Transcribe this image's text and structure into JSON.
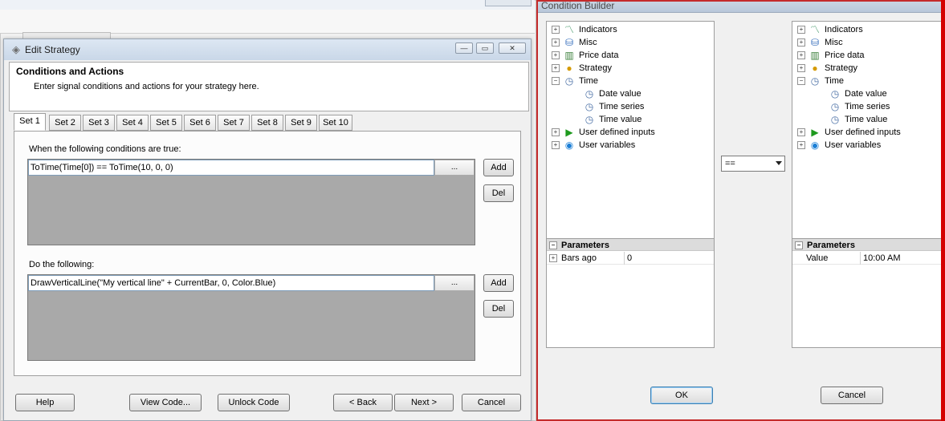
{
  "edit_strategy": {
    "title": "Edit Strategy",
    "header_title": "Conditions and Actions",
    "header_subtitle": "Enter signal conditions and actions for your strategy here.",
    "tabs": [
      "Set 1",
      "Set 2",
      "Set 3",
      "Set 4",
      "Set 5",
      "Set 6",
      "Set 7",
      "Set 8",
      "Set 9",
      "Set 10"
    ],
    "active_tab": "Set 1",
    "conditions_label": "When the following conditions are true:",
    "condition_row": "ToTime(Time[0]) == ToTime(10, 0, 0)",
    "actions_label": "Do the following:",
    "action_row": "DrawVerticalLine(\"My vertical line\" + CurrentBar, 0, Color.Blue)",
    "ellipsis": "...",
    "add_label": "Add",
    "del_label": "Del",
    "buttons": {
      "help": "Help",
      "view_code": "View Code...",
      "unlock_code": "Unlock Code",
      "back": "< Back",
      "next": "Next >",
      "cancel": "Cancel"
    }
  },
  "condition_builder": {
    "title": "Condition Builder",
    "tree": [
      {
        "label": "Indicators",
        "icon": "chart-line-icon",
        "expander": "+"
      },
      {
        "label": "Misc",
        "icon": "database-icon",
        "expander": "+"
      },
      {
        "label": "Price data",
        "icon": "bar-chart-icon",
        "expander": "+"
      },
      {
        "label": "Strategy",
        "icon": "coin-icon",
        "expander": "+"
      },
      {
        "label": "Time",
        "icon": "clock-icon",
        "expander": "-"
      },
      {
        "label": "Date value",
        "icon": "clock-icon",
        "child": true
      },
      {
        "label": "Time series",
        "icon": "clock-icon",
        "child": true
      },
      {
        "label": "Time value",
        "icon": "clock-icon",
        "child": true
      },
      {
        "label": "User defined inputs",
        "icon": "play-icon",
        "expander": "+"
      },
      {
        "label": "User variables",
        "icon": "globe-icon",
        "expander": "+"
      }
    ],
    "params_label": "Parameters",
    "left_params": {
      "name": "Bars ago",
      "value": "0"
    },
    "right_params": {
      "name": "Value",
      "value": "10:00 AM"
    },
    "operator": "==",
    "ok_label": "OK",
    "cancel_label": "Cancel"
  }
}
